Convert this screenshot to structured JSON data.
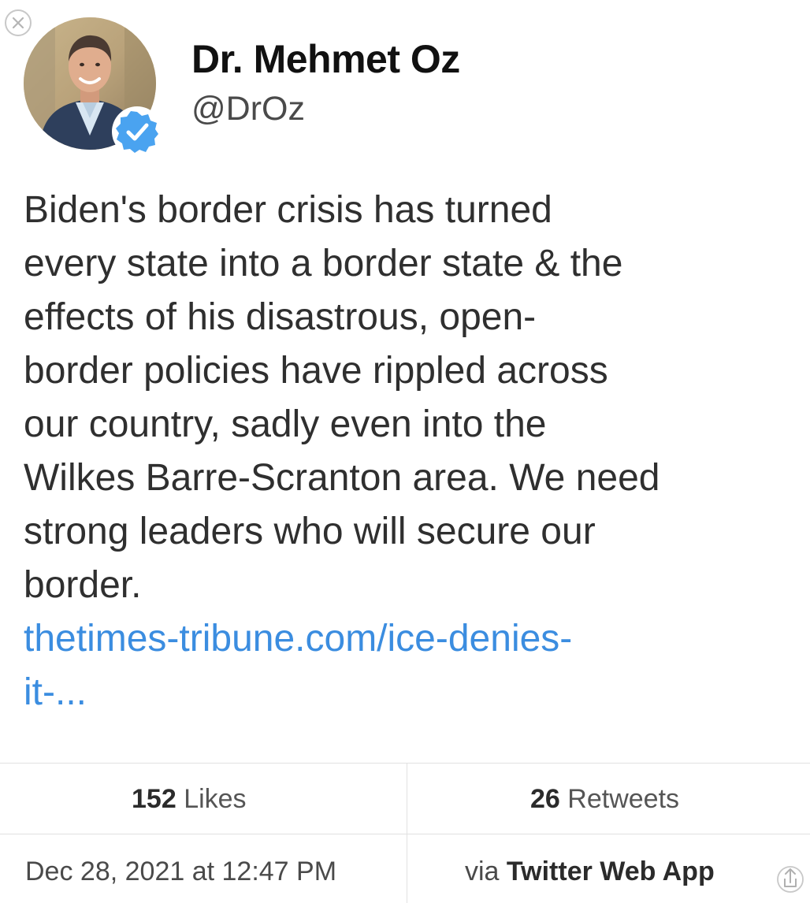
{
  "icons": {
    "close": "close-icon",
    "verified": "verified-badge-icon",
    "share": "share-icon"
  },
  "colors": {
    "link": "#3b8de0",
    "verified": "#4aa3f0"
  },
  "author": {
    "name": "Dr. Mehmet Oz",
    "handle": "@DrOz"
  },
  "tweet": {
    "lines": [
      "Biden's border crisis has turned",
      "every state into a border state & the",
      "effects of his disastrous, open-",
      "border policies have rippled across",
      "our country, sadly even into the",
      "Wilkes Barre-Scranton area. We need",
      "strong leaders who will secure our",
      "border."
    ],
    "link_lines": [
      "thetimes-tribune.com/ice-denies-",
      "it-..."
    ]
  },
  "stats": {
    "likes_count": "152",
    "likes_label": "Likes",
    "retweets_count": "26",
    "retweets_label": "Retweets"
  },
  "meta": {
    "timestamp": "Dec 28, 2021 at 12:47 PM",
    "via_label": "via",
    "source": "Twitter Web App"
  }
}
